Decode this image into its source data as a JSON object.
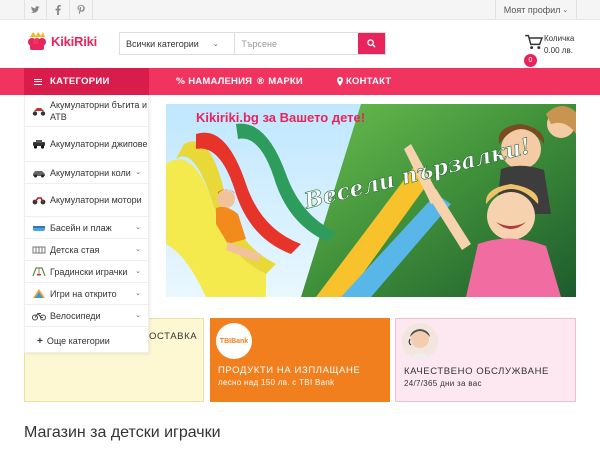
{
  "topbar": {
    "social_icons": [
      "twitter-icon",
      "facebook-icon",
      "pinterest-icon"
    ],
    "profile_label": "Моят профил"
  },
  "header": {
    "logo_text": "KikiRiki",
    "search": {
      "category_selected": "Всички категории",
      "placeholder": "Търсене"
    },
    "cart": {
      "label": "Количка",
      "count": "0",
      "total": "0.00 лв."
    }
  },
  "nav": {
    "categories_label": "КАТЕГОРИИ",
    "links": [
      {
        "label": "НАМАЛЕНИЯ",
        "icon": "%"
      },
      {
        "label": "МАРКИ",
        "icon": "®"
      },
      {
        "label": "КОНТАКТ",
        "icon": "map-pin-icon"
      }
    ]
  },
  "sidebar": {
    "categories": [
      {
        "label": "Акумулаторни бъгита и АТВ",
        "icon": "atv-icon",
        "has_submenu": false
      },
      {
        "label": "Акумулаторни джипове",
        "icon": "jeep-icon",
        "has_submenu": false
      },
      {
        "label": "Акумулаторни коли",
        "icon": "car-icon",
        "has_submenu": true
      },
      {
        "label": "Акумулаторни мотори",
        "icon": "motorcycle-icon",
        "has_submenu": false
      },
      {
        "label": "Басейн и плаж",
        "icon": "pool-icon",
        "has_submenu": true
      },
      {
        "label": "Детска стая",
        "icon": "crib-icon",
        "has_submenu": true
      },
      {
        "label": "Градински играчки",
        "icon": "swing-icon",
        "has_submenu": true
      },
      {
        "label": "Игри на открито",
        "icon": "toy-icon",
        "has_submenu": true
      },
      {
        "label": "Велосипеди",
        "icon": "bicycle-icon",
        "has_submenu": true
      }
    ],
    "more_label": "Още категории"
  },
  "banner": {
    "site_text": "Kikiriki.bg за Вашето дете!",
    "headline": "Весели пързалки!"
  },
  "info_boxes": [
    {
      "title": "ОСТАВКА",
      "subtitle": "",
      "color": "#fdf8d2"
    },
    {
      "badge": "TBIBank",
      "title": "ПРОДУКТИ НА ИЗПЛАЩАНЕ",
      "subtitle": "лесно над 150 лв. с TBI Bank",
      "color": "#f27f1d"
    },
    {
      "title": "КАЧЕСТВЕНО ОБСЛУЖВАНЕ",
      "subtitle": "24/7/365 дни за вас",
      "color": "#fde8f1"
    }
  ],
  "section_heading": "Магазин за детски играчки",
  "colors": {
    "brand_pink": "#f0335f",
    "brand_pink_dark": "#d81d4c",
    "orange": "#f27f1d"
  }
}
